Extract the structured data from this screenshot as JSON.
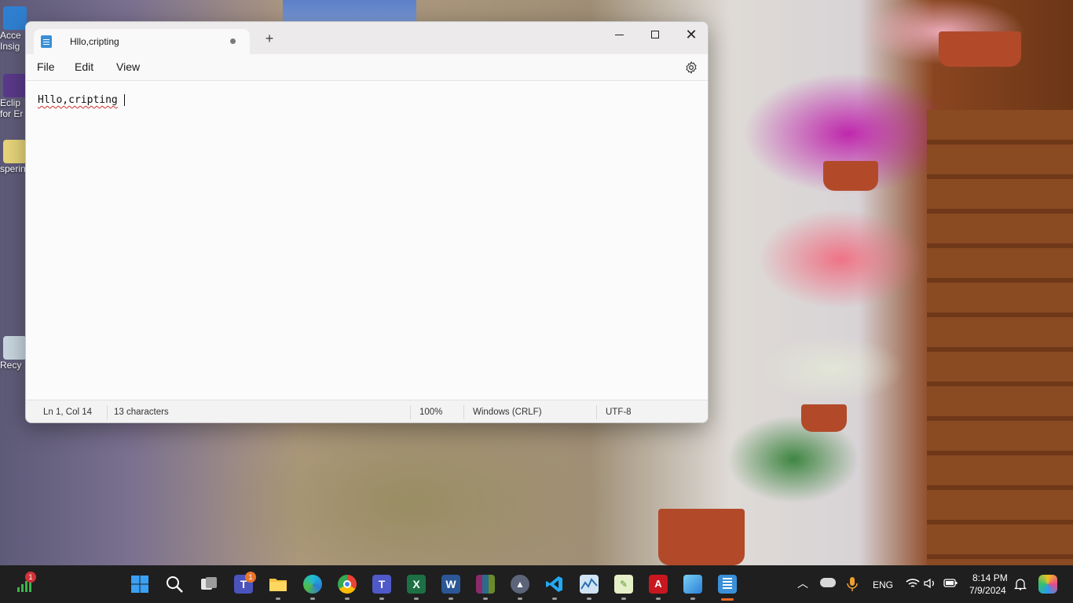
{
  "desktop": {
    "icons": [
      {
        "label": "Acce\nInsig"
      },
      {
        "label": "Eclip\nfor Er"
      },
      {
        "label": "sperin"
      },
      {
        "label": "Recy"
      }
    ]
  },
  "notepad": {
    "tab_title": "Hllo,cripting",
    "new_tab_symbol": "+",
    "menu": {
      "file": "File",
      "edit": "Edit",
      "view": "View"
    },
    "content": "Hllo,cripting",
    "status": {
      "position": "Ln 1, Col 14",
      "characters": "13 characters",
      "zoom": "100%",
      "line_ending": "Windows (CRLF)",
      "encoding": "UTF-8"
    },
    "colors": {
      "spellcheck": "#d03030"
    }
  },
  "taskbar": {
    "apps": [
      {
        "name": "stocks-widget",
        "badge": "1"
      },
      {
        "name": "start"
      },
      {
        "name": "search"
      },
      {
        "name": "task-view"
      },
      {
        "name": "teams-personal",
        "badge": "1"
      },
      {
        "name": "file-explorer"
      },
      {
        "name": "edge"
      },
      {
        "name": "chrome"
      },
      {
        "name": "teams"
      },
      {
        "name": "excel"
      },
      {
        "name": "word"
      },
      {
        "name": "winrar"
      },
      {
        "name": "vpn"
      },
      {
        "name": "vscode"
      },
      {
        "name": "resource-monitor"
      },
      {
        "name": "notepad-plus"
      },
      {
        "name": "acrobat"
      },
      {
        "name": "photos"
      },
      {
        "name": "notepad",
        "active": true
      }
    ],
    "tray": {
      "language": "ENG",
      "time": "8:14 PM",
      "date": "7/9/2024"
    },
    "colors": {
      "active_indicator": "#f36b2a",
      "badge": "#d13438"
    }
  }
}
